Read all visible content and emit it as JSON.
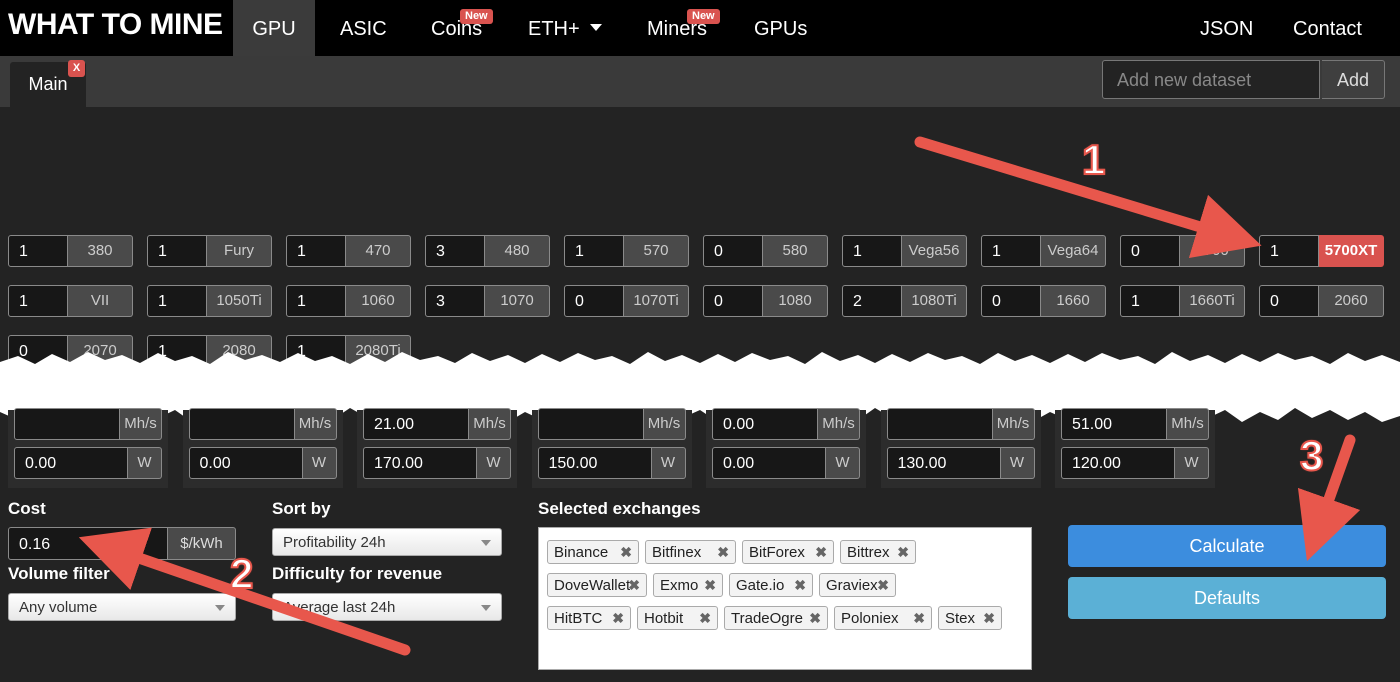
{
  "navbar": {
    "brand": "WHAT TO MINE",
    "items": [
      {
        "label": "GPU"
      },
      {
        "label": "ASIC"
      },
      {
        "label": "Coins",
        "badge": "New"
      },
      {
        "label": "ETH+"
      },
      {
        "label": "Miners",
        "badge": "New"
      },
      {
        "label": "GPUs"
      }
    ],
    "right": [
      {
        "label": "JSON"
      },
      {
        "label": "Contact"
      }
    ]
  },
  "tabs": {
    "main_label": "Main",
    "close_label": "X",
    "dataset_placeholder": "Add new dataset",
    "add_label": "Add"
  },
  "gpus": [
    {
      "count": "1",
      "name": "380"
    },
    {
      "count": "1",
      "name": "Fury"
    },
    {
      "count": "1",
      "name": "470"
    },
    {
      "count": "3",
      "name": "480"
    },
    {
      "count": "1",
      "name": "570"
    },
    {
      "count": "0",
      "name": "580"
    },
    {
      "count": "1",
      "name": "Vega56"
    },
    {
      "count": "1",
      "name": "Vega64"
    },
    {
      "count": "0",
      "name": "5700"
    },
    {
      "count": "1",
      "name": "5700XT",
      "selected": true
    },
    {
      "count": "1",
      "name": "VII"
    },
    {
      "count": "1",
      "name": "1050Ti"
    },
    {
      "count": "1",
      "name": "1060"
    },
    {
      "count": "3",
      "name": "1070"
    },
    {
      "count": "0",
      "name": "1070Ti"
    },
    {
      "count": "0",
      "name": "1080"
    },
    {
      "count": "2",
      "name": "1080Ti"
    },
    {
      "count": "0",
      "name": "1660"
    },
    {
      "count": "1",
      "name": "1660Ti"
    },
    {
      "count": "0",
      "name": "2060"
    },
    {
      "count": "0",
      "name": "2070"
    },
    {
      "count": "1",
      "name": "2080"
    },
    {
      "count": "1",
      "name": "2080Ti"
    }
  ],
  "algo_rows": [
    {
      "hashrate": "",
      "hash_unit": "Mh/s",
      "power": "0.00",
      "power_unit": "W"
    },
    {
      "hashrate": "",
      "hash_unit": "Mh/s",
      "power": "0.00",
      "power_unit": "W"
    },
    {
      "hashrate": "21.00",
      "hash_unit": "Mh/s",
      "power": "170.00",
      "power_unit": "W"
    },
    {
      "hashrate": "",
      "hash_unit": "Mh/s",
      "power": "150.00",
      "power_unit": "W"
    },
    {
      "hashrate": "0.00",
      "hash_unit": "Mh/s",
      "power": "0.00",
      "power_unit": "W"
    },
    {
      "hashrate": "",
      "hash_unit": "Mh/s",
      "power": "130.00",
      "power_unit": "W"
    },
    {
      "hashrate": "51.00",
      "hash_unit": "Mh/s",
      "power": "120.00",
      "power_unit": "W"
    }
  ],
  "settings": {
    "cost_label": "Cost",
    "cost_value": "0.16",
    "cost_unit": "$/kWh",
    "volume_label": "Volume filter",
    "volume_value": "Any volume",
    "sort_label": "Sort by",
    "sort_value": "Profitability 24h",
    "difficulty_label": "Difficulty for revenue",
    "difficulty_value": "Average last 24h"
  },
  "exchanges": {
    "label": "Selected exchanges",
    "items": [
      "Binance",
      "Bitfinex",
      "BitForex",
      "Bittrex",
      "DoveWallet",
      "Exmo",
      "Gate.io",
      "Graviex",
      "HitBTC",
      "Hotbit",
      "TradeOgre",
      "Poloniex",
      "Stex"
    ]
  },
  "buttons": {
    "calculate": "Calculate",
    "defaults": "Defaults"
  },
  "annotations": [
    "1",
    "2",
    "3"
  ],
  "colors": {
    "accent_red": "#d9534f",
    "arrow_red": "#e8574c",
    "calc_blue": "#3c8dde",
    "defaults_blue": "#5bb0d6"
  }
}
